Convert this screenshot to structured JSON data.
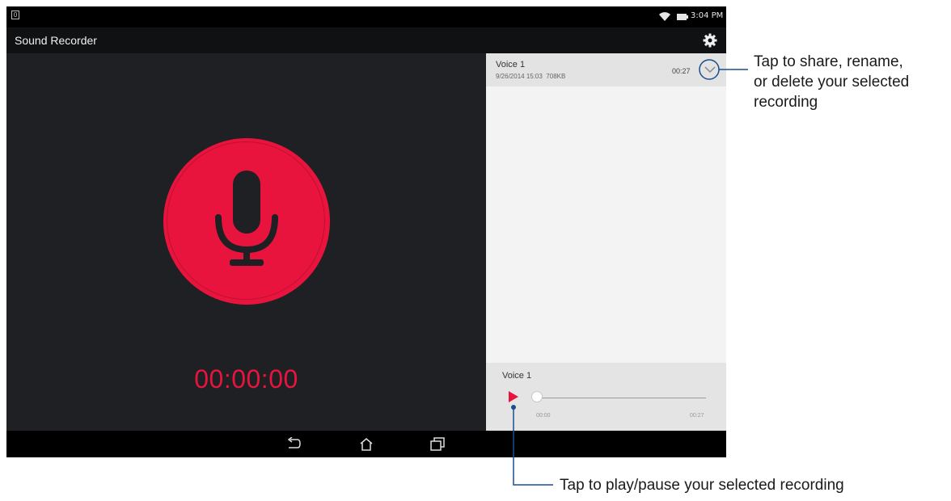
{
  "status_bar": {
    "time": "3:04 PM",
    "notification": "0"
  },
  "app": {
    "title": "Sound Recorder"
  },
  "recorder": {
    "timer": "00:00:00"
  },
  "recordings": [
    {
      "name": "Voice 1",
      "date": "9/26/2014 15:03",
      "size": "708KB",
      "duration": "00:27"
    }
  ],
  "player": {
    "name": "Voice 1",
    "elapsed": "00:00",
    "total": "00:27"
  },
  "callouts": {
    "top": [
      "Tap to share, rename,",
      "or delete your selected",
      "recording"
    ],
    "bottom": "Tap to play/pause your selected recording"
  },
  "colors": {
    "accent": "#e8143e",
    "callout_line": "#1a4f8f",
    "background": "#1e2024"
  },
  "icons": [
    "wifi-icon",
    "battery-icon",
    "settings-gear-icon",
    "microphone-icon",
    "chevron-down-icon",
    "play-icon",
    "back-icon",
    "home-icon",
    "recent-apps-icon"
  ]
}
